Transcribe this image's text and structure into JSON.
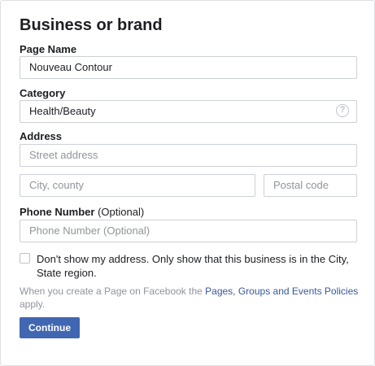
{
  "dialog": {
    "title": "Business or brand"
  },
  "form": {
    "page_name": {
      "label": "Page Name",
      "value": "Nouveau Contour"
    },
    "category": {
      "label": "Category",
      "value": "Health/Beauty",
      "help_glyph": "?"
    },
    "address": {
      "label": "Address",
      "street_placeholder": "Street address",
      "city_placeholder": "City, county",
      "postal_placeholder": "Postal code"
    },
    "phone": {
      "label": "Phone Number",
      "optional_text": "(Optional)",
      "placeholder": "Phone Number (Optional)"
    },
    "hide_address": {
      "checked": false,
      "label": "Don't show my address. Only show that this business is in the City, State region."
    }
  },
  "policy": {
    "prefix": "When you create a Page on Facebook the ",
    "link_text": "Pages, Groups and Events Policies",
    "suffix": " apply."
  },
  "actions": {
    "continue_label": "Continue"
  },
  "colors": {
    "primary_button": "#4267b2",
    "link": "#365899",
    "placeholder_text": "#90949c",
    "input_border": "#ccd0d5"
  }
}
